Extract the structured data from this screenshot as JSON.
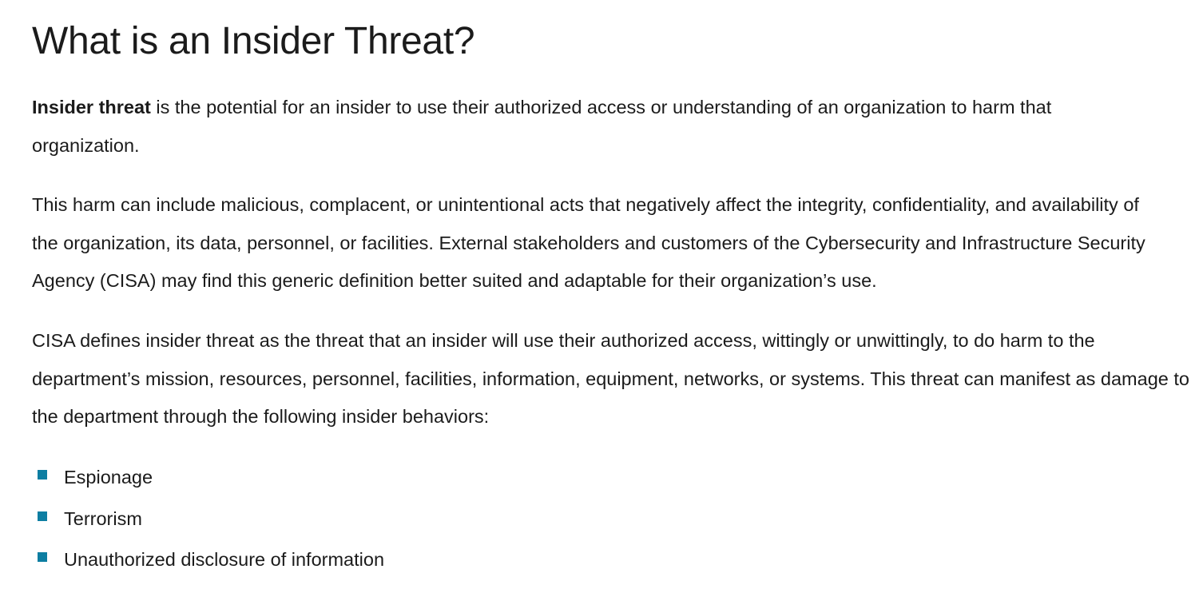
{
  "page": {
    "title": "What is an Insider Threat?"
  },
  "paragraphs": {
    "p1_bold": "Insider threat",
    "p1_rest": " is the potential for an insider to use their authorized access or understanding of an organization to harm that organization.",
    "p2": "This harm can include malicious, complacent, or unintentional acts that negatively affect the integrity, confidentiality, and availability of the organization, its data, personnel, or facilities. External stakeholders and customers of the Cybersecurity and Infrastructure Security Agency (CISA) may find this generic definition better suited and adaptable for their organization’s use.",
    "p3": "CISA defines insider threat as the threat that an insider will use their authorized access, wittingly or unwittingly, to do harm to the department’s mission, resources, personnel, facilities, information, equipment, networks, or systems. This threat can manifest as damage to the department through the following insider behaviors:"
  },
  "behaviors": [
    "Espionage",
    "Terrorism",
    "Unauthorized disclosure of information"
  ],
  "colors": {
    "text": "#1b1b1b",
    "bullet": "#0d7ea2",
    "background": "#ffffff"
  }
}
